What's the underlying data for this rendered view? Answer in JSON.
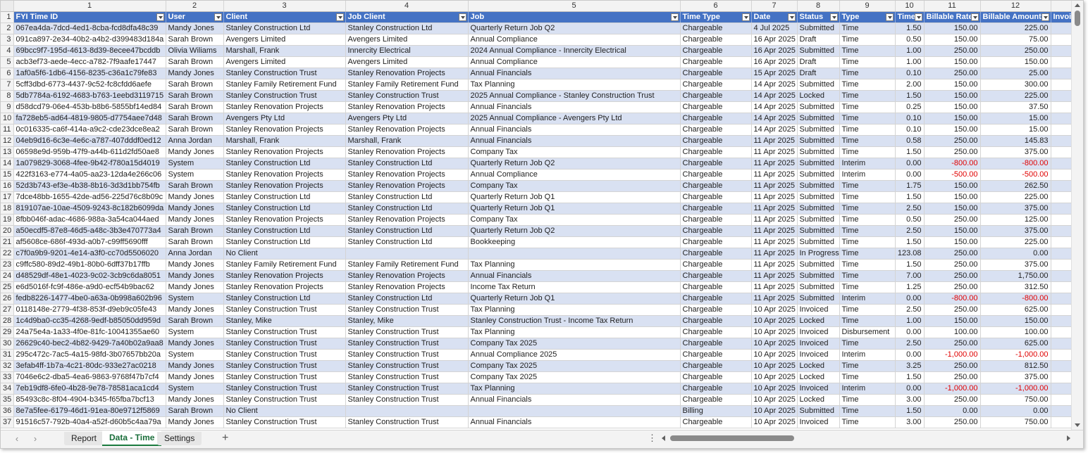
{
  "column_numbers": [
    "1",
    "2",
    "3",
    "4",
    "5",
    "6",
    "7",
    "8",
    "9",
    "10",
    "11",
    "12"
  ],
  "headers": [
    "FYI Time ID",
    "User",
    "Client",
    "Job Client",
    "Job",
    "Time Type",
    "Date",
    "Status",
    "Type",
    "Time",
    "Billable Rate",
    "Billable Amount",
    "Invoi"
  ],
  "rows": [
    [
      "2",
      "067ea4da-7dcd-4ed1-8cba-fcd8dfa48c39",
      "Mandy Jones",
      "Stanley Construction Ltd",
      "Stanley Construction Ltd",
      "Quarterly Return Job Q2",
      "Chargeable",
      "4 Jul 2025",
      "Submitted",
      "Time",
      "1.50",
      "150.00",
      "225.00"
    ],
    [
      "3",
      "091ca897-2e34-40b2-a4b2-d399483d184a",
      "Sarah Brown",
      "Avengers Limited",
      "Avengers Limited",
      "Annual Compliance",
      "Chargeable",
      "16 Apr 2025",
      "Draft",
      "Time",
      "0.50",
      "150.00",
      "75.00"
    ],
    [
      "4",
      "69bcc9f7-195d-4613-8d39-8ecee47bcddb",
      "Olivia Wiliams",
      "Marshall, Frank",
      "Innercity Electrical",
      "2024 Annual Compliance - Innercity Electrical",
      "Chargeable",
      "16 Apr 2025",
      "Submitted",
      "Time",
      "1.00",
      "250.00",
      "250.00"
    ],
    [
      "5",
      "acb3ef73-aede-4ecc-a782-7f9aafe17447",
      "Sarah Brown",
      "Avengers Limited",
      "Avengers Limited",
      "Annual Compliance",
      "Chargeable",
      "16 Apr 2025",
      "Draft",
      "Time",
      "1.00",
      "150.00",
      "150.00"
    ],
    [
      "6",
      "1af0a5f6-1db6-4156-8235-c36a1c79fe83",
      "Mandy Jones",
      "Stanley Construction Trust",
      "Stanley Renovation Projects",
      "Annual Financials",
      "Chargeable",
      "15 Apr 2025",
      "Draft",
      "Time",
      "0.10",
      "250.00",
      "25.00"
    ],
    [
      "7",
      "5cff3dbd-6773-4437-9c52-fc8cfdd6aefe",
      "Sarah Brown",
      "Stanley Family Retirement Fund",
      "Stanley Family Retirement Fund",
      "Tax Planning",
      "Chargeable",
      "14 Apr 2025",
      "Submitted",
      "Time",
      "2.00",
      "150.00",
      "300.00"
    ],
    [
      "8",
      "5db7784a-6192-4683-b763-1eebd3119715",
      "Sarah Brown",
      "Stanley Construction Trust",
      "Stanley Construction Trust",
      "2025 Annual Compliance - Stanley Construction Trust",
      "Chargeable",
      "14 Apr 2025",
      "Locked",
      "Time",
      "1.50",
      "150.00",
      "225.00"
    ],
    [
      "9",
      "d58dcd79-06e4-453b-b8b6-5855bf14ed84",
      "Sarah Brown",
      "Stanley Renovation Projects",
      "Stanley Renovation Projects",
      "Annual Financials",
      "Chargeable",
      "14 Apr 2025",
      "Submitted",
      "Time",
      "0.25",
      "150.00",
      "37.50"
    ],
    [
      "10",
      "fa728eb5-ad64-4819-9805-d7754aee7d48",
      "Sarah Brown",
      "Avengers Pty Ltd",
      "Avengers Pty Ltd",
      "2025 Annual Compliance - Avengers Pty Ltd",
      "Chargeable",
      "14 Apr 2025",
      "Submitted",
      "Time",
      "0.10",
      "150.00",
      "15.00"
    ],
    [
      "11",
      "0c016335-ca6f-414a-a9c2-cde23dce8ea2",
      "Sarah Brown",
      "Stanley Renovation Projects",
      "Stanley Renovation Projects",
      "Annual Financials",
      "Chargeable",
      "14 Apr 2025",
      "Submitted",
      "Time",
      "0.10",
      "150.00",
      "15.00"
    ],
    [
      "12",
      "04eb9d16-6c3e-4e6c-a787-407dddf0ed12",
      "Anna Jordan",
      "Marshall, Frank",
      "Marshall, Frank",
      "Annual Financials",
      "Chargeable",
      "11 Apr 2025",
      "Submitted",
      "Time",
      "0.58",
      "250.00",
      "145.83"
    ],
    [
      "13",
      "06598e9d-959b-47f9-a44b-611d2fd50ae8",
      "Mandy Jones",
      "Stanley Renovation Projects",
      "Stanley Renovation Projects",
      "Company Tax",
      "Chargeable",
      "11 Apr 2025",
      "Submitted",
      "Time",
      "1.50",
      "250.00",
      "375.00"
    ],
    [
      "14",
      "1a079829-3068-4fee-9b42-f780a15d4019",
      "System",
      "Stanley Construction Ltd",
      "Stanley Construction Ltd",
      "Quarterly Return Job Q2",
      "Chargeable",
      "11 Apr 2025",
      "Submitted",
      "Interim",
      "0.00",
      "-800.00",
      "-800.00"
    ],
    [
      "15",
      "422f3163-e774-4a05-aa23-12da4e266c06",
      "System",
      "Stanley Renovation Projects",
      "Stanley Renovation Projects",
      "Annual Compliance",
      "Chargeable",
      "11 Apr 2025",
      "Submitted",
      "Interim",
      "0.00",
      "-500.00",
      "-500.00"
    ],
    [
      "16",
      "52d3b743-ef3e-4b38-8b16-3d3d1bb754fb",
      "Sarah Brown",
      "Stanley Renovation Projects",
      "Stanley Renovation Projects",
      "Company Tax",
      "Chargeable",
      "11 Apr 2025",
      "Submitted",
      "Time",
      "1.75",
      "150.00",
      "262.50"
    ],
    [
      "17",
      "7dce48bb-1655-42de-ad56-225d76c8b09c",
      "Mandy Jones",
      "Stanley Construction Ltd",
      "Stanley Construction Ltd",
      "Quarterly Return Job Q1",
      "Chargeable",
      "11 Apr 2025",
      "Submitted",
      "Time",
      "1.50",
      "150.00",
      "225.00"
    ],
    [
      "18",
      "819107ae-10ae-4509-9243-8c182b6099da",
      "Mandy Jones",
      "Stanley Construction Ltd",
      "Stanley Construction Ltd",
      "Quarterly Return Job Q1",
      "Chargeable",
      "11 Apr 2025",
      "Submitted",
      "Time",
      "2.50",
      "150.00",
      "375.00"
    ],
    [
      "19",
      "8fbb046f-adac-4686-988a-3a54ca044aed",
      "Mandy Jones",
      "Stanley Renovation Projects",
      "Stanley Renovation Projects",
      "Company Tax",
      "Chargeable",
      "11 Apr 2025",
      "Submitted",
      "Time",
      "0.50",
      "250.00",
      "125.00"
    ],
    [
      "20",
      "a50ecdf5-87e8-46d5-a48c-3b3e470773a4",
      "Sarah Brown",
      "Stanley Construction Ltd",
      "Stanley Construction Ltd",
      "Quarterly Return Job Q2",
      "Chargeable",
      "11 Apr 2025",
      "Submitted",
      "Time",
      "2.50",
      "150.00",
      "375.00"
    ],
    [
      "21",
      "af5608ce-686f-493d-a0b7-c99ff5690fff",
      "Sarah Brown",
      "Stanley Construction Ltd",
      "Stanley Construction Ltd",
      "Bookkeeping",
      "Chargeable",
      "11 Apr 2025",
      "Submitted",
      "Time",
      "1.50",
      "150.00",
      "225.00"
    ],
    [
      "22",
      "c7f0a9b9-9201-4e14-a3f0-cc70d5506020",
      "Anna Jordan",
      "No Client",
      "",
      "",
      "Chargeable",
      "11 Apr 2025",
      "In Progress",
      "Time",
      "123.08",
      "250.00",
      "0.00"
    ],
    [
      "23",
      "c9ffc580-89d2-49b1-80b0-6dff37b17ffb",
      "Mandy Jones",
      "Stanley Family Retirement Fund",
      "Stanley Family Retirement Fund",
      "Tax Planning",
      "Chargeable",
      "11 Apr 2025",
      "Submitted",
      "Time",
      "1.50",
      "250.00",
      "375.00"
    ],
    [
      "24",
      "d48529df-48e1-4023-9c02-3cb9c6da8051",
      "Mandy Jones",
      "Stanley Renovation Projects",
      "Stanley Renovation Projects",
      "Annual Financials",
      "Chargeable",
      "11 Apr 2025",
      "Submitted",
      "Time",
      "7.00",
      "250.00",
      "1,750.00"
    ],
    [
      "25",
      "e6d5016f-fc9f-486e-a9d0-ecf54b9bac62",
      "Mandy Jones",
      "Stanley Renovation Projects",
      "Stanley Renovation Projects",
      "Income Tax Return",
      "Chargeable",
      "11 Apr 2025",
      "Submitted",
      "Time",
      "1.25",
      "250.00",
      "312.50"
    ],
    [
      "26",
      "fedb8226-1477-4be0-a63a-0b998a602b96",
      "System",
      "Stanley Construction Ltd",
      "Stanley Construction Ltd",
      "Quarterly Return Job Q1",
      "Chargeable",
      "11 Apr 2025",
      "Submitted",
      "Interim",
      "0.00",
      "-800.00",
      "-800.00"
    ],
    [
      "27",
      "0118148e-2779-4f38-853f-d9eb9c05fe43",
      "Mandy Jones",
      "Stanley Construction Trust",
      "Stanley Construction Trust",
      "Tax Planning",
      "Chargeable",
      "10 Apr 2025",
      "Invoiced",
      "Time",
      "2.50",
      "250.00",
      "625.00"
    ],
    [
      "28",
      "1c4d9ba0-cc35-4268-9edf-b85050dd959d",
      "Sarah Brown",
      "Stanley, Mike",
      "Stanley, Mike",
      "Stanley Construction Trust - Income Tax Return",
      "Chargeable",
      "10 Apr 2025",
      "Locked",
      "Time",
      "1.00",
      "150.00",
      "150.00"
    ],
    [
      "29",
      "24a75e4a-1a33-4f0e-81fc-10041355ae60",
      "System",
      "Stanley Construction Trust",
      "Stanley Construction Trust",
      "Tax Planning",
      "Chargeable",
      "10 Apr 2025",
      "Invoiced",
      "Disbursement",
      "0.00",
      "100.00",
      "100.00"
    ],
    [
      "30",
      "26629c40-bec2-4b82-9429-7a40b02a9aa8",
      "Mandy Jones",
      "Stanley Construction Trust",
      "Stanley Construction Trust",
      "Company Tax  2025",
      "Chargeable",
      "10 Apr 2025",
      "Invoiced",
      "Time",
      "2.50",
      "250.00",
      "625.00"
    ],
    [
      "31",
      "295c472c-7ac5-4a15-98fd-3b07657bb20a",
      "System",
      "Stanley Construction Trust",
      "Stanley Construction Trust",
      "Annual Compliance 2025",
      "Chargeable",
      "10 Apr 2025",
      "Invoiced",
      "Interim",
      "0.00",
      "-1,000.00",
      "-1,000.00"
    ],
    [
      "32",
      "3efab4ff-1b7a-4c21-80dc-933e27ac0218",
      "Mandy Jones",
      "Stanley Construction Trust",
      "Stanley Construction Trust",
      "Company Tax  2025",
      "Chargeable",
      "10 Apr 2025",
      "Locked",
      "Time",
      "3.25",
      "250.00",
      "812.50"
    ],
    [
      "33",
      "7046e6c2-dba5-4ea6-9863-9768f47b7cf4",
      "Mandy Jones",
      "Stanley Construction Trust",
      "Stanley Construction Trust",
      "Company Tax  2025",
      "Chargeable",
      "10 Apr 2025",
      "Locked",
      "Time",
      "1.50",
      "250.00",
      "375.00"
    ],
    [
      "34",
      "7eb19df8-6fe0-4b28-9e78-78581aca1cd4",
      "System",
      "Stanley Construction Trust",
      "Stanley Construction Trust",
      "Tax Planning",
      "Chargeable",
      "10 Apr 2025",
      "Invoiced",
      "Interim",
      "0.00",
      "-1,000.00",
      "-1,000.00"
    ],
    [
      "35",
      "85493c8c-8f04-4904-b345-f65fba7bcf13",
      "Mandy Jones",
      "Stanley Construction Trust",
      "Stanley Construction Trust",
      "Annual Financials",
      "Chargeable",
      "10 Apr 2025",
      "Locked",
      "Time",
      "3.00",
      "250.00",
      "750.00"
    ],
    [
      "36",
      "8e7a5fee-6179-46d1-91ea-80e9712f5869",
      "Sarah Brown",
      "No Client",
      "",
      "",
      "Billing",
      "10 Apr 2025",
      "Submitted",
      "Time",
      "1.50",
      "0.00",
      "0.00"
    ],
    [
      "37",
      "91516c57-792b-40a4-a52f-d60b5c4aa79a",
      "Mandy Jones",
      "Stanley Construction Trust",
      "Stanley Construction Trust",
      "Annual Financials",
      "Chargeable",
      "10 Apr 2025",
      "Invoiced",
      "Time",
      "3.00",
      "250.00",
      "750.00"
    ]
  ],
  "tabs": [
    {
      "label": "Report",
      "active": false
    },
    {
      "label": "Data - Time",
      "active": true
    },
    {
      "label": "Settings",
      "active": false
    }
  ],
  "header_row_number": "1",
  "colors": {
    "header_bg": "#4472c4",
    "band_bg": "#d9e1f2",
    "negative": "#e00000",
    "active_tab": "#1a6e3a"
  }
}
